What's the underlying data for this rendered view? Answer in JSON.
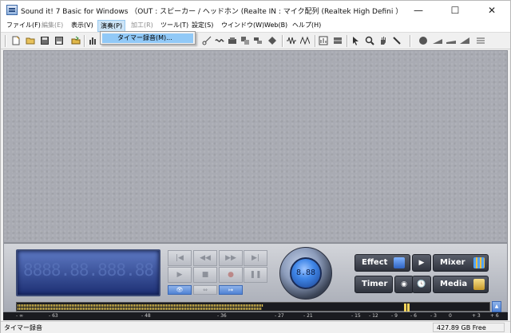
{
  "window": {
    "title": "Sound it! 7 Basic for Windows （OUT : スピーカー / ヘッドホン (Realte  IN : マイク配列 (Realtek High Defini ）",
    "controls": {
      "minimize": "—",
      "maximize": "☐",
      "close": "✕"
    }
  },
  "menubar": {
    "items": [
      {
        "label": "ファイル(F)",
        "disabled": false
      },
      {
        "label": "編集(E)",
        "disabled": true
      },
      {
        "label": "表示(V)",
        "disabled": false
      },
      {
        "label": "演奏(P)",
        "disabled": false,
        "active": true
      },
      {
        "label": "加工(R)",
        "disabled": true
      },
      {
        "label": "ツール(T)",
        "disabled": false
      },
      {
        "label": "設定(S)",
        "disabled": false
      },
      {
        "label": "ウインドウ(W)",
        "disabled": false
      },
      {
        "label": "Web(B)",
        "disabled": false
      },
      {
        "label": "ヘルプ(H)",
        "disabled": false
      }
    ]
  },
  "dropdown": {
    "item": "タイマー録音(M)..."
  },
  "toolbar": {
    "icons": [
      "new-file-icon",
      "open-folder-icon",
      "save-icon",
      "save-as-icon",
      "open-recent-icon",
      "chart-icon",
      "cut-icon",
      "copy-icon",
      "paste-icon",
      "crop-icon",
      "mix-paste-icon",
      "delete-icon",
      "waveform-icon",
      "spectrum-icon",
      "grid-view-icon",
      "cursor-icon",
      "zoom-icon",
      "hand-icon",
      "pencil-icon",
      "record-dot-icon",
      "fade-in-icon",
      "fade-out-icon",
      "volume-icon",
      "level-meter-icon"
    ]
  },
  "transport": {
    "counter": "8888.88.888.88",
    "buttons": [
      "|◀",
      "◀◀",
      "▶▶",
      "▶|",
      "▶",
      "■",
      "●",
      "❚❚"
    ],
    "small_buttons": [
      "👁",
      "⇔",
      "↦"
    ],
    "knob_value": "8.88"
  },
  "functions": {
    "effect": "Effect",
    "timer": "Timer",
    "mixer": "Mixer",
    "media": "Media",
    "play": "▶",
    "record": "◉",
    "clock": "🕓"
  },
  "meter": {
    "level": 0.52,
    "peak": 0.82,
    "scale": [
      "- ∞",
      "- 63",
      "- 48",
      "- 36",
      "- 27",
      "- 21",
      "- 15",
      "- 12",
      "- 9",
      "- 6",
      "- 3",
      "0",
      "+ 3",
      "+ 6"
    ],
    "button": "▲"
  },
  "statusbar": {
    "text": "タイマー録音",
    "free_space": "427.89 GB Free"
  }
}
